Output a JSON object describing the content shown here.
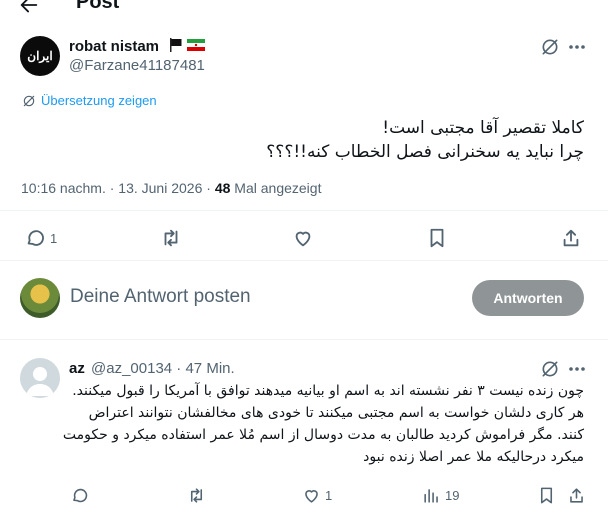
{
  "header": {
    "title": "Post"
  },
  "tweet": {
    "author_name": "robat nistam",
    "author_handle": "@Farzane41187481",
    "avatar_text": "ایران",
    "translate_label": "Übersetzung zeigen",
    "text_lines": [
      "کاملا تقصیر آقا مجتبی است!",
      "چرا نباید یه سخنرانی فصل الخطاب کنه!!؟؟؟"
    ],
    "time": "10:16 nachm.",
    "date": "13. Juni 2026",
    "views": "48",
    "views_label": "Mal angezeigt",
    "reply_count": "1"
  },
  "compose": {
    "placeholder": "Deine Antwort posten",
    "button_label": "Antworten"
  },
  "reply": {
    "name": "az",
    "handle": "@az_00134",
    "age": "47 Min.",
    "text_lines": [
      "چون زنده نیست ۳ نفر نشسته اند به اسم او بیانیه میدهند توافق با آمریکا را قبول میکنند.",
      "هر کاری دلشان خواست به اسم مجتبی میکنند تا خودی های مخالفشان نتوانند اعتراض",
      "کنند. مگر فراموش کردید طالبان به مدت دوسال از اسم مُلا عمر استفاده میکرد و حکومت",
      "میکرد درحالیکه ملا عمر اصلا زنده نبود"
    ],
    "like_count": "1",
    "views_count": "19"
  },
  "colors": {
    "accent": "#1d9bf0",
    "muted": "#536471",
    "button_disabled": "#8f9496"
  }
}
